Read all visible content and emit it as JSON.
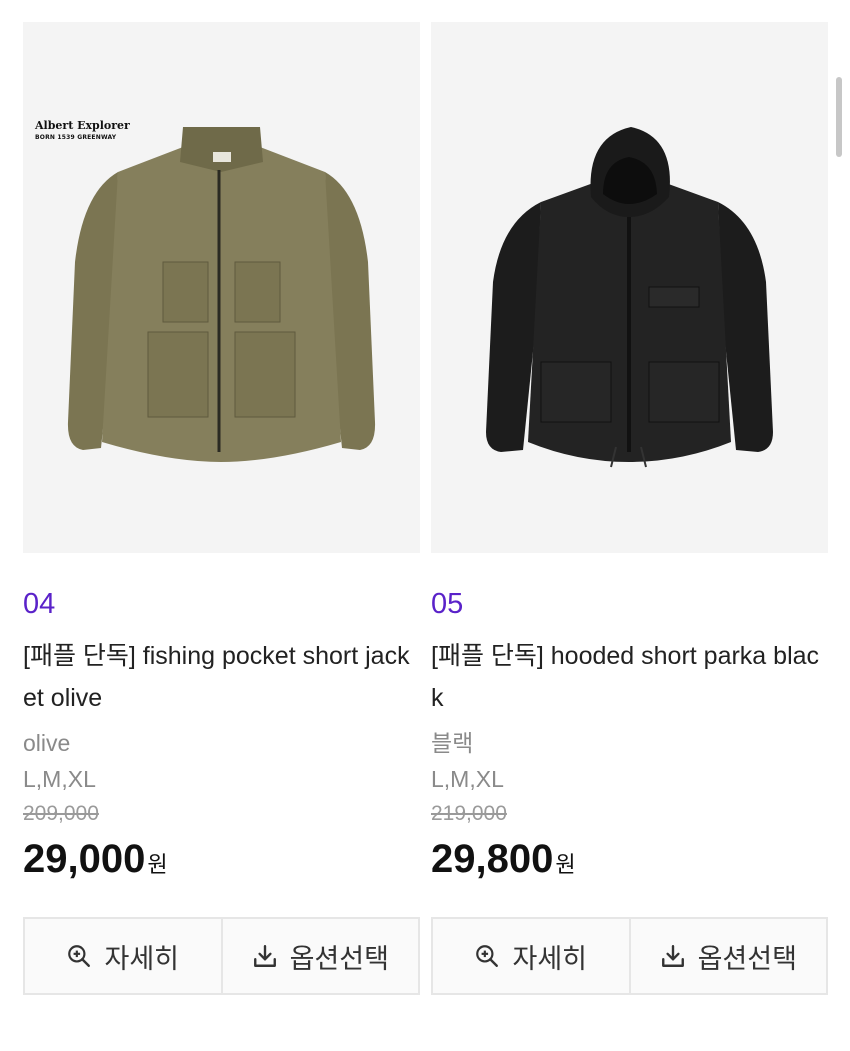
{
  "products": [
    {
      "rank": "04",
      "name": "[패플 단독] fishing pocket short jacket olive",
      "color": "olive",
      "sizes": "L,M,XL",
      "original_price": "209,000",
      "price": "29,000",
      "currency": "원",
      "brand_logo_line1": "Albert Explorer",
      "brand_logo_line2": "BORN 1539 GREENWAY",
      "garment_color": "#7b7552"
    },
    {
      "rank": "05",
      "name": "[패플 단독] hooded short parka black",
      "color": "블랙",
      "sizes": "L,M,XL",
      "original_price": "219,000",
      "price": "29,800",
      "currency": "원",
      "garment_color": "#1c1c1c"
    }
  ],
  "buttons": {
    "detail_label": "자세히",
    "option_label": "옵션선택",
    "detail_icon": "zoom-in-icon",
    "option_icon": "download-icon"
  },
  "colors": {
    "rank_accent": "#5a22c9",
    "image_bg": "#f4f4f4"
  }
}
